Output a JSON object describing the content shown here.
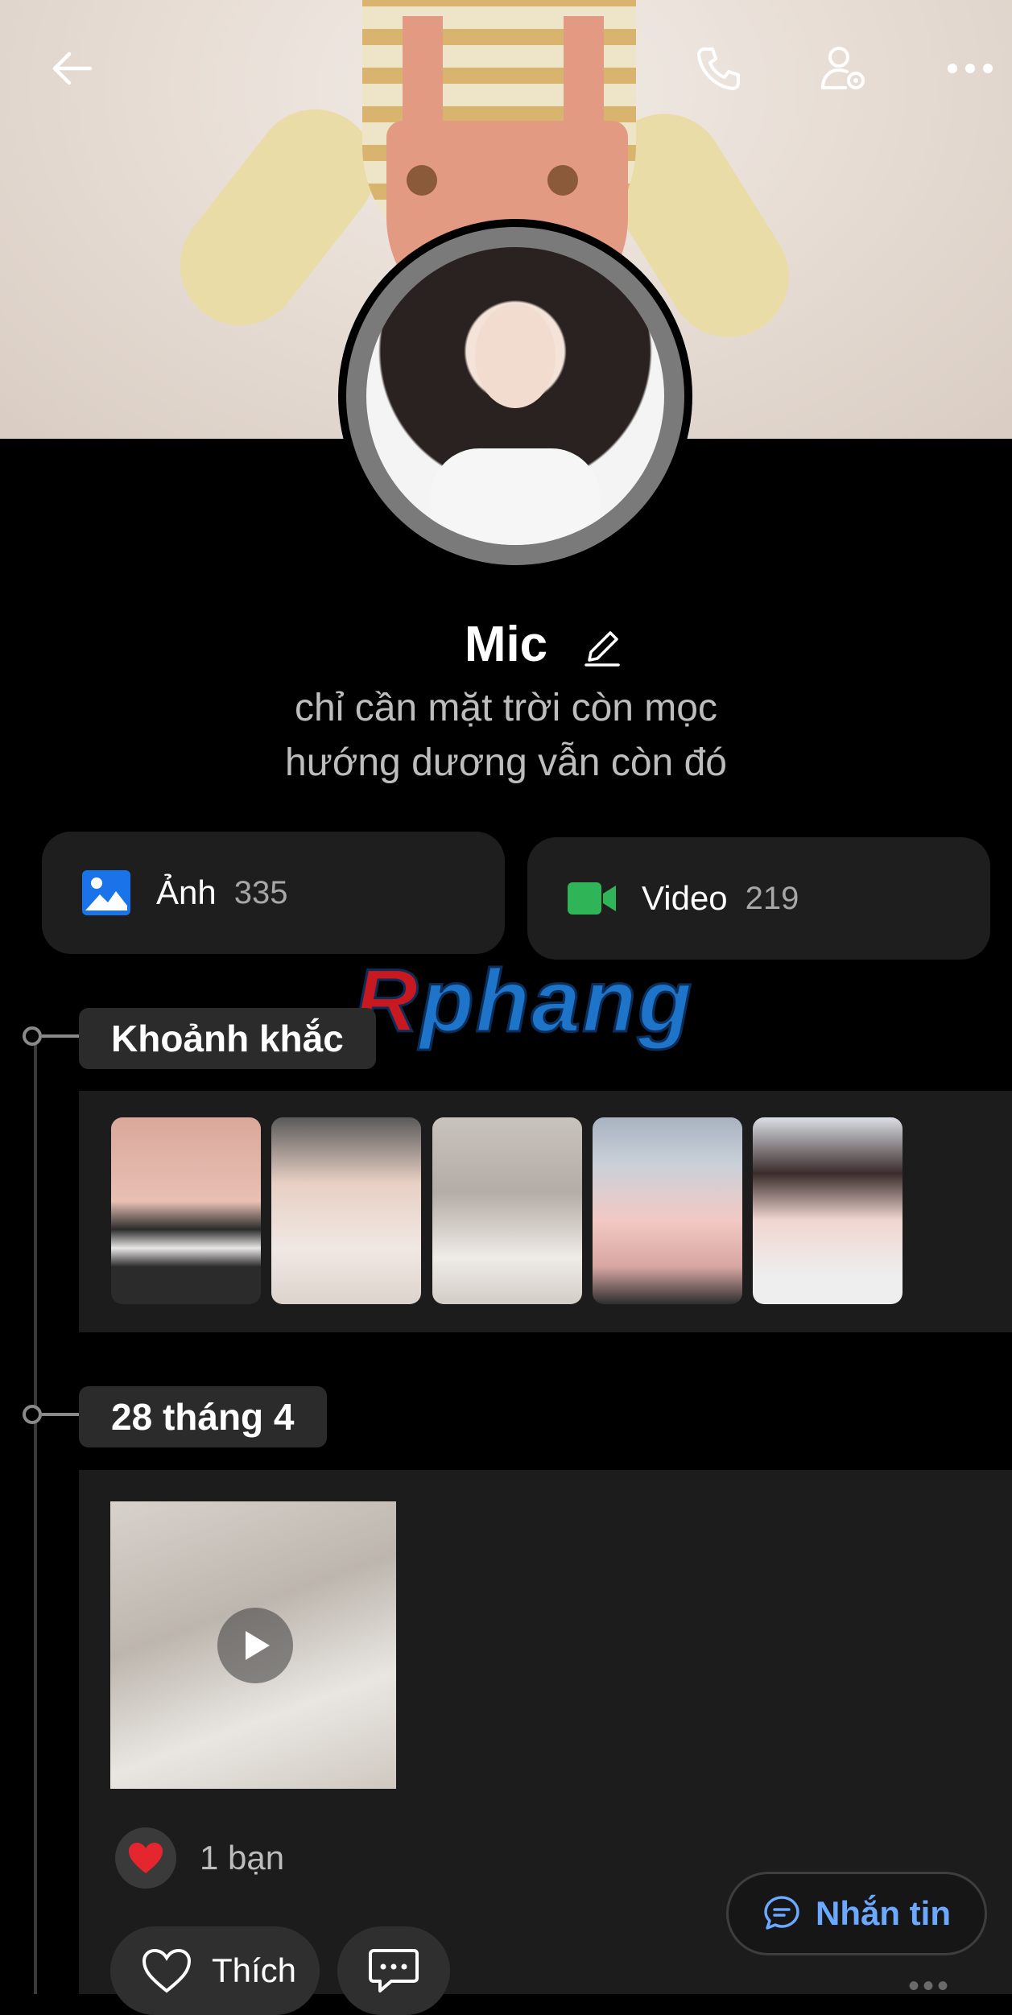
{
  "header": {
    "back_icon": "arrow-left-icon",
    "call_icon": "phone-icon",
    "settings_icon": "user-gear-icon",
    "more_icon": "more-horizontal-icon"
  },
  "profile": {
    "name": "Mic",
    "bio_line1": "chỉ cần mặt trời còn mọc",
    "bio_line2": "hướng dương vẫn còn đó"
  },
  "media": {
    "photos": {
      "label": "Ảnh",
      "count": "335",
      "icon": "image-icon",
      "color": "#1a73e8"
    },
    "videos": {
      "label": "Video",
      "count": "219",
      "icon": "video-camera-icon",
      "color": "#2fb457"
    }
  },
  "watermark": {
    "text_first": "R",
    "text_rest": "phang"
  },
  "moments": {
    "label": "Khoảnh khắc",
    "count": 5
  },
  "post": {
    "date_label": "28 tháng 4",
    "reaction_text": "1 bạn",
    "like_label": "Thích",
    "comment_icon": "comment-icon"
  },
  "message_button": {
    "label": "Nhắn tin",
    "icon": "chat-icon"
  },
  "colors": {
    "background": "#000000",
    "card": "#1e1e1e",
    "accent_blue": "#6aa9ff"
  }
}
